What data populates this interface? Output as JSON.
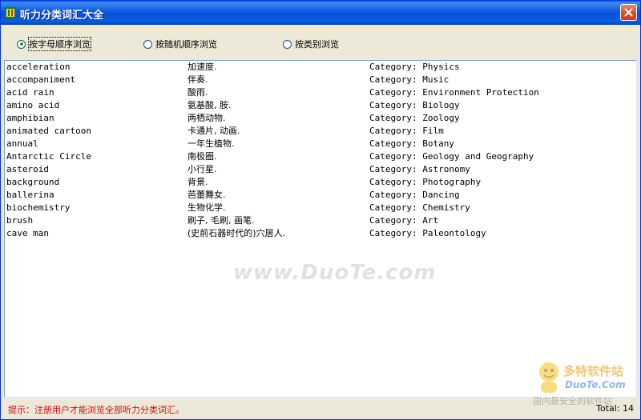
{
  "window": {
    "title": "听力分类词汇大全"
  },
  "icons": {
    "app": "app-icon",
    "close": "close-icon"
  },
  "view_options": [
    {
      "label": "按字母顺序浏览",
      "selected": true
    },
    {
      "label": "按随机顺序浏览",
      "selected": false
    },
    {
      "label": "按类别浏览",
      "selected": false
    }
  ],
  "words": [
    {
      "word": "acceleration",
      "meaning": "加速度.",
      "category": "Category: Physics"
    },
    {
      "word": "accompaniment",
      "meaning": "伴奏.",
      "category": "Category: Music"
    },
    {
      "word": "acid rain",
      "meaning": "酸雨.",
      "category": "Category: Environment Protection"
    },
    {
      "word": "amino acid",
      "meaning": "氨基酸, 胺.",
      "category": "Category: Biology"
    },
    {
      "word": "amphibian",
      "meaning": "两栖动物.",
      "category": "Category: Zoology"
    },
    {
      "word": "animated cartoon",
      "meaning": "卡通片, 动画.",
      "category": "Category: Film"
    },
    {
      "word": "annual",
      "meaning": "一年生植物.",
      "category": "Category: Botany"
    },
    {
      "word": "Antarctic Circle",
      "meaning": "南极圈.",
      "category": "Category: Geology and Geography"
    },
    {
      "word": "asteroid",
      "meaning": "小行星.",
      "category": "Category: Astronomy"
    },
    {
      "word": "background",
      "meaning": "背景.",
      "category": "Category: Photography"
    },
    {
      "word": "ballerina",
      "meaning": "芭蕾舞女.",
      "category": "Category: Dancing"
    },
    {
      "word": "biochemistry",
      "meaning": "生物化学.",
      "category": "Category: Chemistry"
    },
    {
      "word": "brush",
      "meaning": "刷子, 毛刷, 画笔.",
      "category": "Category: Art"
    },
    {
      "word": "cave man",
      "meaning": "(史前石器时代的)穴居人.",
      "category": "Category: Paleontology"
    }
  ],
  "status": {
    "hint": "提示：注册用户才能浏览全部听力分类词汇。",
    "total": "Total: 14"
  },
  "watermarks": {
    "center": "www.DuoTe.com",
    "logo_line1": "多特软件站",
    "logo_line2": "DuoTe.Com",
    "logo_line3": "国内最安全的软件站"
  },
  "colors": {
    "titlebar": "#0b58dd",
    "close_button": "#d5512d",
    "hint_text": "#e0000f",
    "radio_dot": "#21a121"
  }
}
